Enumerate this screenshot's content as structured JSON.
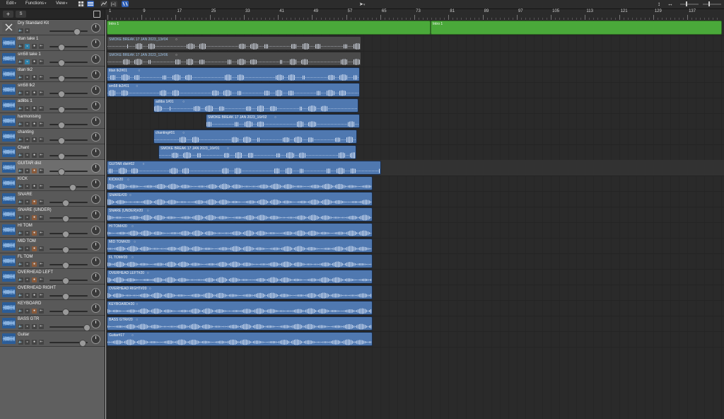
{
  "menu": {
    "edit": "Edit",
    "functions": "Functions",
    "view": "View"
  },
  "ruler": {
    "bars": [
      "1",
      "9",
      "17",
      "25",
      "33",
      "41",
      "49",
      "57",
      "65",
      "73",
      "81",
      "89",
      "97",
      "105",
      "113",
      "121",
      "129",
      "137"
    ]
  },
  "colors": {
    "audio_region": "#4f78b0",
    "drummer_region": "#4aa93a",
    "muted_region": "#4a4a4a"
  },
  "tracks": [
    {
      "name": "Dry Standard Kit",
      "type": "drummer"
    },
    {
      "name": "titan take 1",
      "type": "audio"
    },
    {
      "name": "sm58 take 1",
      "type": "audio"
    },
    {
      "name": "titan tk2",
      "type": "audio"
    },
    {
      "name": "sm58 tk2",
      "type": "audio"
    },
    {
      "name": "adlibs 1",
      "type": "audio"
    },
    {
      "name": "harmonising",
      "type": "audio"
    },
    {
      "name": "chanting",
      "type": "audio"
    },
    {
      "name": "Chant",
      "type": "audio"
    },
    {
      "name": "GUITAR dist",
      "type": "audio"
    },
    {
      "name": "KICK",
      "type": "audio"
    },
    {
      "name": "SNARE",
      "type": "audio"
    },
    {
      "name": "SNARE (UNDER)",
      "type": "audio"
    },
    {
      "name": "HI TOM",
      "type": "audio"
    },
    {
      "name": "MID TOM",
      "type": "audio"
    },
    {
      "name": "FL TOM",
      "type": "audio"
    },
    {
      "name": "OVERHEAD LEFT",
      "type": "audio"
    },
    {
      "name": "OVERHEAD RIGHT",
      "type": "audio"
    },
    {
      "name": "KEYBOARD",
      "type": "audio"
    },
    {
      "name": "BASS GTR",
      "type": "audio"
    },
    {
      "name": "Guitar",
      "type": "audio"
    }
  ],
  "regions": [
    {
      "track": 0,
      "name": "Intro 1",
      "kind": "green"
    },
    {
      "track": 0,
      "name": "Intro 1",
      "kind": "green"
    },
    {
      "track": 1,
      "name": "SMOKE BREAK 17 JAN 2023_13#04",
      "kind": "gray"
    },
    {
      "track": 2,
      "name": "SMOKE BREAK 17 JAN 2023_12#06",
      "kind": "gray"
    },
    {
      "track": 3,
      "name": "titan tk2#01",
      "kind": "blue"
    },
    {
      "track": 4,
      "name": "sm58 tk2#01",
      "kind": "blue"
    },
    {
      "track": 5,
      "name": "adlibs 1#01",
      "kind": "blue"
    },
    {
      "track": 6,
      "name": "SMOKE BREAK 17 JAN 2023_16#02",
      "kind": "blue"
    },
    {
      "track": 7,
      "name": "chanting#01",
      "kind": "blue"
    },
    {
      "track": 8,
      "name": "SMOKE BREAK 17 JAN 2023_16#01",
      "kind": "blue"
    },
    {
      "track": 9,
      "name": "GUITAR dist#02",
      "kind": "blue"
    },
    {
      "track": 10,
      "name": "KICK#20",
      "kind": "blue"
    },
    {
      "track": 11,
      "name": "SNARE#20",
      "kind": "blue"
    },
    {
      "track": 12,
      "name": "SNARE (UNDER)#20",
      "kind": "blue"
    },
    {
      "track": 13,
      "name": "HI TOM#20",
      "kind": "blue"
    },
    {
      "track": 14,
      "name": "MID TOM#20",
      "kind": "blue"
    },
    {
      "track": 15,
      "name": "FL TOM#20",
      "kind": "blue"
    },
    {
      "track": 16,
      "name": "OVERHEAD LEFT#20",
      "kind": "blue"
    },
    {
      "track": 17,
      "name": "OVERHEAD RIGHT#20",
      "kind": "blue"
    },
    {
      "track": 18,
      "name": "KEYBOARD#20",
      "kind": "blue"
    },
    {
      "track": 19,
      "name": "BASS GTR#20",
      "kind": "blue"
    },
    {
      "track": 20,
      "name": "Guitar#17",
      "kind": "blue"
    }
  ]
}
